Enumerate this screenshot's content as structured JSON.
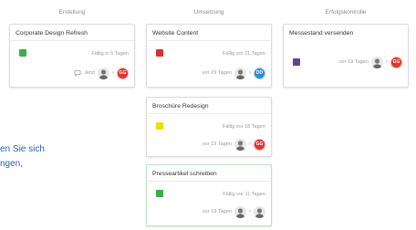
{
  "columns": [
    {
      "title": "Erstellung"
    },
    {
      "title": "Umsetzung"
    },
    {
      "title": "Erfolgskontrolle"
    }
  ],
  "cards": [
    {
      "title": "Corporate Design Refresh",
      "label_color": "#3cae48",
      "due": "Fällig in 5 Tagen",
      "meta": "Jetzt",
      "has_chat": true,
      "assignee_initials": "GG",
      "assignee_color": "#e0352b"
    },
    {
      "title": "Website Content",
      "label_color": "#e22d2d",
      "due": "Fällig vor 21 Tagen",
      "meta": "vor 19 Tagen",
      "has_chat": false,
      "assignee_initials": "DD",
      "assignee_color": "#2f8fd6"
    },
    {
      "title": "Broschüre Redesign",
      "label_color": "#f5d90e",
      "due": "Fällig vor 18 Tagen",
      "meta": "vor 19 Tagen",
      "has_chat": false,
      "assignee_initials": "GG",
      "assignee_color": "#e0352b"
    },
    {
      "title": "Presseartikel schreiben",
      "label_color": "#3cae48",
      "due": "Fällig vor 11 Tagen",
      "meta": "vor 19 Tagen",
      "has_chat": false,
      "assignee_initials": "",
      "assignee_color": ""
    },
    {
      "title": "Messestand versenden",
      "label_color": "#6a3d9a",
      "due": "",
      "meta": "vor 19 Tagen",
      "has_chat": false,
      "assignee_initials": "GG",
      "assignee_color": "#e0352b"
    }
  ],
  "side_text": {
    "line1": "en Sie sich",
    "line2": "ngen,"
  }
}
